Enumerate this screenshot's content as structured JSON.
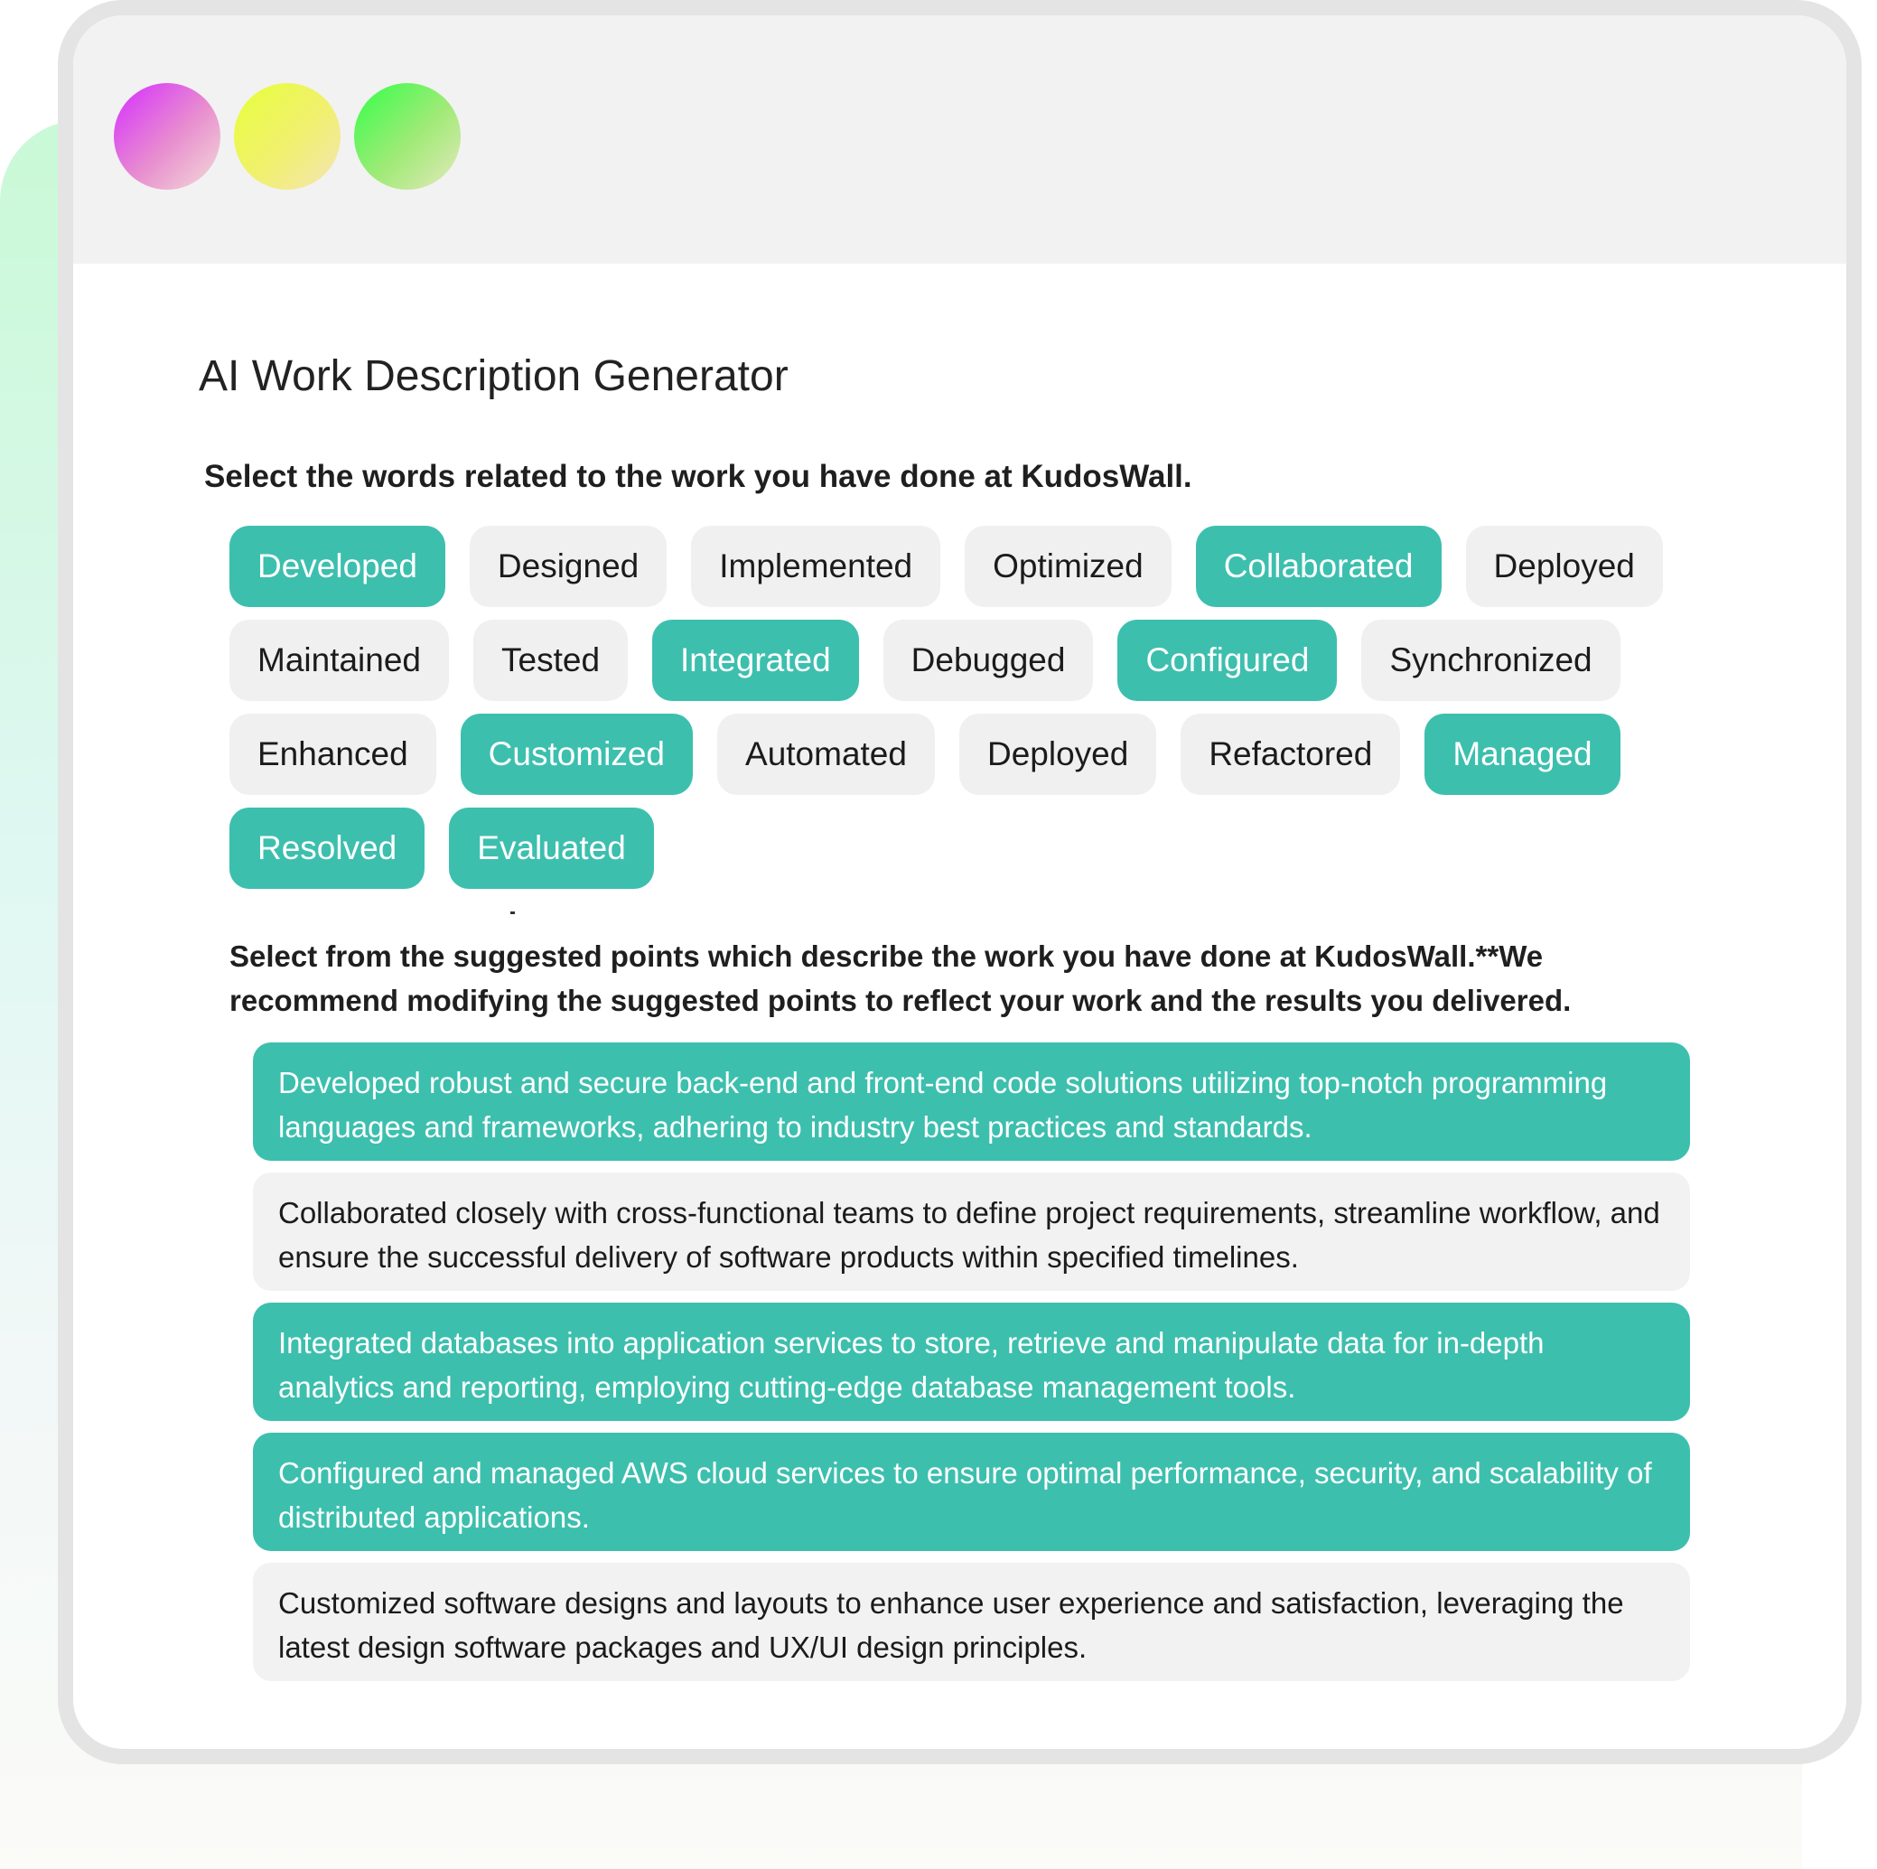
{
  "page": {
    "title": "AI Work Description Generator",
    "accent_color": "#3dbfae"
  },
  "window": {
    "controls": [
      {
        "name": "window-dot-magenta",
        "color": "#d52cff"
      },
      {
        "name": "window-dot-yellow",
        "color": "#e7ff3a"
      },
      {
        "name": "window-dot-green",
        "color": "#33ff4a"
      }
    ]
  },
  "words_section": {
    "instruction": "Select the words related to the work you have done at KudosWall.",
    "words": [
      {
        "label": "Developed",
        "selected": true
      },
      {
        "label": "Designed",
        "selected": false
      },
      {
        "label": "Implemented",
        "selected": false
      },
      {
        "label": "Optimized",
        "selected": false
      },
      {
        "label": "Collaborated",
        "selected": true
      },
      {
        "label": "Deployed",
        "selected": false
      },
      {
        "label": "Maintained",
        "selected": false
      },
      {
        "label": "Tested",
        "selected": false
      },
      {
        "label": "Integrated",
        "selected": true
      },
      {
        "label": "Debugged",
        "selected": false
      },
      {
        "label": "Configured",
        "selected": true
      },
      {
        "label": "Synchronized",
        "selected": false
      },
      {
        "label": "Enhanced",
        "selected": false
      },
      {
        "label": "Customized",
        "selected": true
      },
      {
        "label": "Automated",
        "selected": false
      },
      {
        "label": "Deployed",
        "selected": false
      },
      {
        "label": "Refactored",
        "selected": false
      },
      {
        "label": "Managed",
        "selected": true
      },
      {
        "label": "Resolved",
        "selected": true
      },
      {
        "label": "Evaluated",
        "selected": true
      }
    ]
  },
  "points_section": {
    "instruction": "Select from the suggested points which describe the work you have done at KudosWall.**We recommend modifying the suggested points to reflect your work and the results you delivered.",
    "points": [
      {
        "text": "Developed robust and secure back-end and front-end code solutions utilizing top-notch programming languages and frameworks, adhering to industry best practices and standards.",
        "selected": true
      },
      {
        "text": "Collaborated closely with cross-functional teams to define project requirements, streamline workflow, and ensure the successful delivery of software products within specified timelines.",
        "selected": false
      },
      {
        "text": "Integrated databases into application services to store, retrieve and manipulate data for in-depth analytics and reporting, employing cutting-edge database management tools.",
        "selected": true
      },
      {
        "text": "Configured and managed AWS cloud services to ensure optimal performance, security, and scalability of distributed applications.",
        "selected": true
      },
      {
        "text": "Customized software designs and layouts to enhance user experience and satisfaction, leveraging the latest design software packages and UX/UI design principles.",
        "selected": false
      }
    ]
  }
}
